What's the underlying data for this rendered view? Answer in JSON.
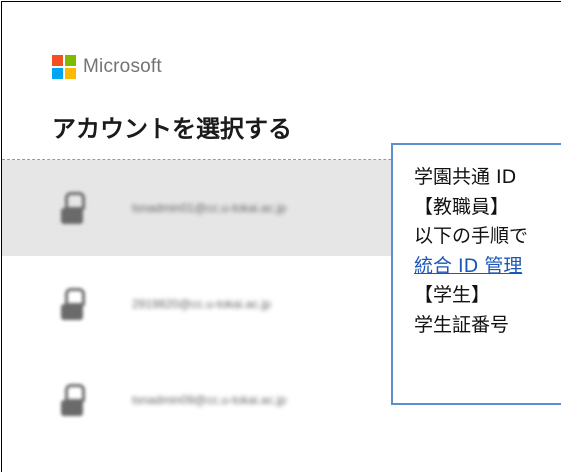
{
  "brand": {
    "name": "Microsoft",
    "logo_colors": [
      "#f25022",
      "#7fba00",
      "#00a4ef",
      "#ffb900"
    ]
  },
  "page": {
    "title": "アカウントを選択する"
  },
  "accounts": [
    {
      "email": "tsnadmin01@cc.u-tokai.ac.jp",
      "selected": true
    },
    {
      "email": "2919820@cc.u-tokai.ac.jp",
      "selected": false
    },
    {
      "email": "tsnadmin09@cc.u-tokai.ac.jp",
      "selected": false
    }
  ],
  "tooltip": {
    "lines": [
      {
        "text": "学園共通 ID",
        "link": false
      },
      {
        "text": "【教職員】",
        "link": false
      },
      {
        "text": "以下の手順で",
        "link": false
      },
      {
        "text": "統合 ID 管理",
        "link": true
      },
      {
        "text": "【学生】",
        "link": false
      },
      {
        "text": "学生証番号",
        "link": false
      }
    ]
  }
}
